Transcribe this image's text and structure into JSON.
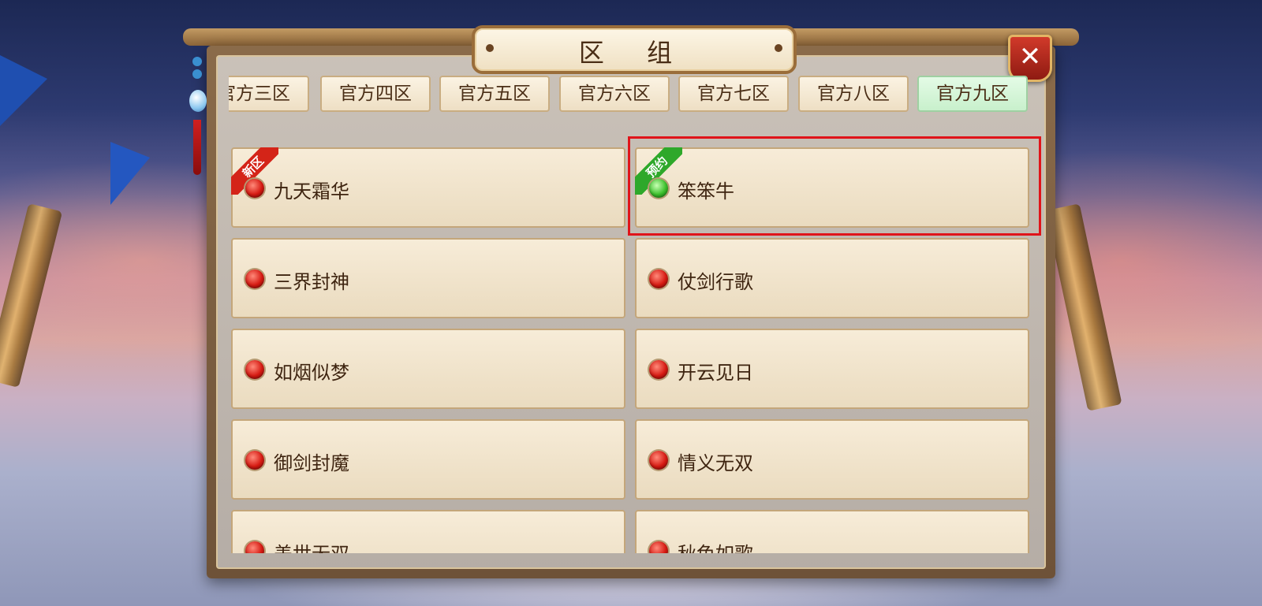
{
  "dialog": {
    "title": "区 组",
    "close_label": "✕"
  },
  "tabs": [
    {
      "label": "官方三区",
      "active": false
    },
    {
      "label": "官方四区",
      "active": false
    },
    {
      "label": "官方五区",
      "active": false
    },
    {
      "label": "官方六区",
      "active": false
    },
    {
      "label": "官方七区",
      "active": false
    },
    {
      "label": "官方八区",
      "active": false
    },
    {
      "label": "官方九区",
      "active": true
    }
  ],
  "servers": [
    {
      "name": "九天霜华",
      "status": "red",
      "badge": "新区"
    },
    {
      "name": "笨笨牛",
      "status": "green",
      "badge": "预约",
      "selected": true
    },
    {
      "name": "三界封神",
      "status": "red"
    },
    {
      "name": "仗剑行歌",
      "status": "red"
    },
    {
      "name": "如烟似梦",
      "status": "red"
    },
    {
      "name": "开云见日",
      "status": "red"
    },
    {
      "name": "御剑封魔",
      "status": "red"
    },
    {
      "name": "情义无双",
      "status": "red"
    },
    {
      "name": "盖世无双",
      "status": "red"
    },
    {
      "name": "秋色如歌",
      "status": "red"
    }
  ],
  "colors": {
    "status_red": "#d61a12",
    "status_green": "#3cc02c",
    "highlight": "#e0141a"
  }
}
